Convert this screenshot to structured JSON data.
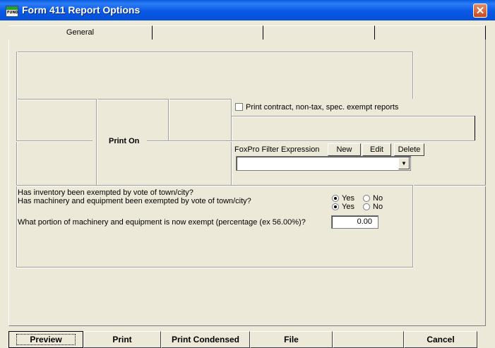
{
  "window": {
    "title": "Form 411 Report Options",
    "icon_text": "FUND",
    "close_glyph": "✕"
  },
  "tabs": [
    "General",
    "",
    "",
    ""
  ],
  "print_on_label": "Print On",
  "checkbox_label": "Print contract, non-tax, spec. exempt reports",
  "filter": {
    "label": "FoxPro Filter Expression",
    "new_label": "New",
    "edit_label": "Edit",
    "delete_label": "Delete",
    "value": "",
    "dropdown_glyph": "▼"
  },
  "questions": {
    "inventory": "Has inventory been exempted by vote of town/city?",
    "machinery": "Has machinery and equipment been exempted by vote of town/city?",
    "portion": "What portion of machinery and equipment is now exempt (percentage (ex 56.00%)?",
    "yes": "Yes",
    "no": "No",
    "inventory_selected": "Yes",
    "machinery_selected": "Yes",
    "portion_value": "0.00"
  },
  "buttons": {
    "preview": "Preview",
    "print": "Print",
    "print_condensed": "Print Condensed",
    "file": "File",
    "cancel": "Cancel"
  }
}
